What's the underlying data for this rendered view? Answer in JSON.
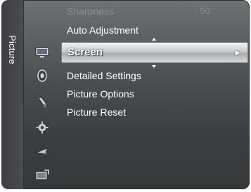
{
  "side_tab": {
    "label": "Picture"
  },
  "icons": [
    {
      "name": "picture-icon",
      "active": true
    },
    {
      "name": "sound-icon",
      "active": false
    },
    {
      "name": "channel-icon",
      "active": false
    },
    {
      "name": "setup-icon",
      "active": false
    },
    {
      "name": "input-icon",
      "active": false
    },
    {
      "name": "application-icon",
      "active": false
    }
  ],
  "menu": {
    "sharpness": {
      "label": "Sharpness",
      "value": ": 50"
    },
    "items": [
      {
        "label": "Auto Adjustment"
      },
      {
        "label": "Screen",
        "selected": true,
        "arrow": "►"
      },
      {
        "label": "Detailed Settings"
      },
      {
        "label": "Picture Options"
      },
      {
        "label": "Picture Reset"
      }
    ]
  },
  "colors": {
    "panel_top": "#6f7275",
    "panel_bottom": "#363839",
    "highlight": "#c7c9cb",
    "text": "#ffffff",
    "dim_text": "#8a8d90"
  }
}
